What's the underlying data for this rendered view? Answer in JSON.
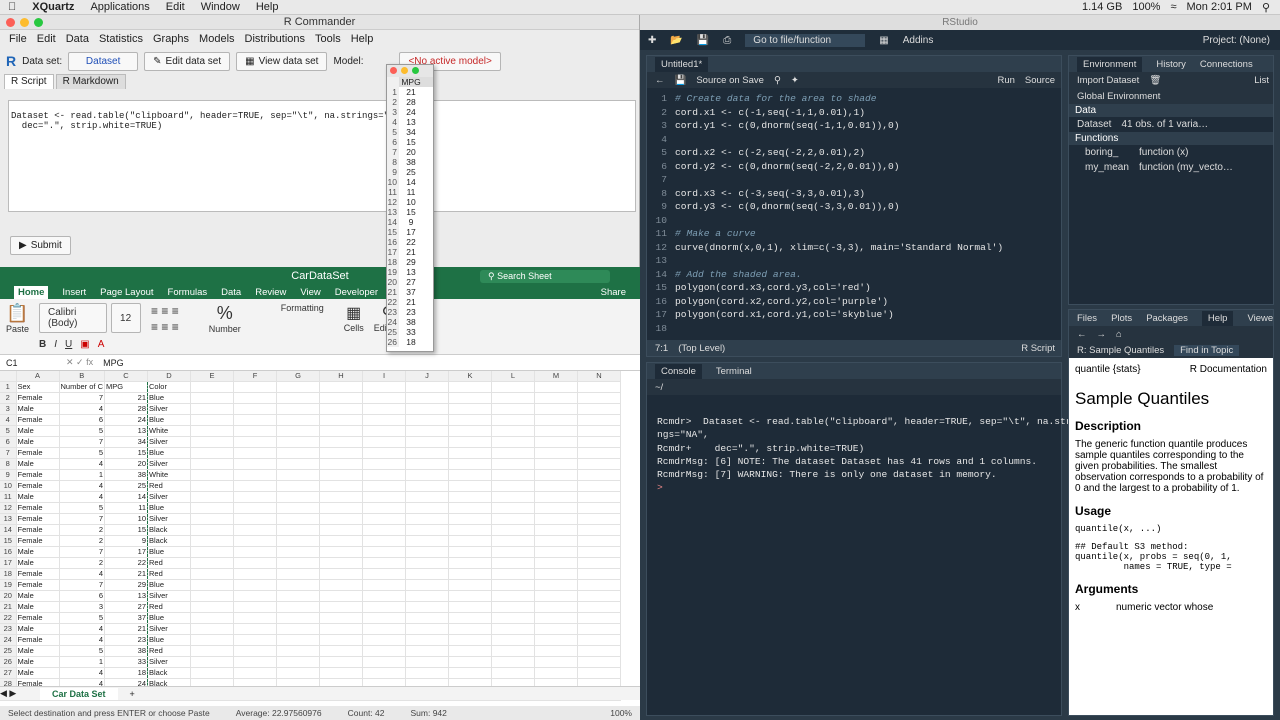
{
  "menubar": {
    "app": "XQuartz",
    "items": [
      "Applications",
      "Edit",
      "Window",
      "Help"
    ],
    "status": "1.14 GB",
    "battery": "100%",
    "time": "Mon 2:01 PM"
  },
  "rcmdr": {
    "title": "R Commander",
    "menu": [
      "File",
      "Edit",
      "Data",
      "Statistics",
      "Graphs",
      "Models",
      "Distributions",
      "Tools",
      "Help"
    ],
    "dataset_label": "Data set:",
    "dataset_value": "Dataset",
    "edit_btn": "Edit data set",
    "view_btn": "View data set",
    "model_label": "Model:",
    "model_value": "<No active model>",
    "tabs": [
      "R Script",
      "R Markdown"
    ],
    "script_line1": "Dataset <- read.table(\"clipboard\", header=TRUE, sep=\"\\t\", na.strings=\"N",
    "script_line2": "  dec=\".\", strip.white=TRUE)",
    "submit": "Submit"
  },
  "mpg_popup": {
    "header": "MPG",
    "rows": [
      "21",
      "28",
      "24",
      "13",
      "34",
      "15",
      "20",
      "38",
      "25",
      "14",
      "11",
      "10",
      "15",
      "9",
      "17",
      "22",
      "21",
      "29",
      "13",
      "27",
      "37",
      "21",
      "23",
      "38",
      "33",
      "18"
    ]
  },
  "excel": {
    "title": "CarDataSet",
    "search_placeholder": "Search Sheet",
    "tabs": [
      "Home",
      "Insert",
      "Page Layout",
      "Formulas",
      "Data",
      "Review",
      "View",
      "Developer"
    ],
    "share": "Share",
    "font": "Calibri (Body)",
    "size": "12",
    "paste": "Paste",
    "number": "Number",
    "cells": "Cells",
    "editing": "Editing",
    "formatting": "Formatting",
    "cellref": "C1",
    "formula": "MPG",
    "cols": [
      "A",
      "B",
      "C",
      "D",
      "E",
      "F",
      "G",
      "H",
      "I",
      "J",
      "K",
      "L",
      "M",
      "N"
    ],
    "header": [
      "Sex",
      "Number of C",
      "MPG",
      "Color"
    ],
    "rows": [
      [
        "Female",
        "7",
        "21",
        "Blue"
      ],
      [
        "Male",
        "4",
        "28",
        "Silver"
      ],
      [
        "Female",
        "6",
        "24",
        "Blue"
      ],
      [
        "Male",
        "5",
        "13",
        "White"
      ],
      [
        "Male",
        "7",
        "34",
        "Silver"
      ],
      [
        "Female",
        "5",
        "15",
        "Blue"
      ],
      [
        "Male",
        "4",
        "20",
        "Silver"
      ],
      [
        "Female",
        "1",
        "38",
        "White"
      ],
      [
        "Female",
        "4",
        "25",
        "Red"
      ],
      [
        "Male",
        "4",
        "14",
        "Silver"
      ],
      [
        "Female",
        "5",
        "11",
        "Blue"
      ],
      [
        "Female",
        "7",
        "10",
        "Silver"
      ],
      [
        "Female",
        "2",
        "15",
        "Black"
      ],
      [
        "Female",
        "2",
        "9",
        "Black"
      ],
      [
        "Male",
        "7",
        "17",
        "Blue"
      ],
      [
        "Male",
        "2",
        "22",
        "Red"
      ],
      [
        "Female",
        "4",
        "21",
        "Red"
      ],
      [
        "Female",
        "7",
        "29",
        "Blue"
      ],
      [
        "Male",
        "6",
        "13",
        "Silver"
      ],
      [
        "Male",
        "3",
        "27",
        "Red"
      ],
      [
        "Female",
        "5",
        "37",
        "Blue"
      ],
      [
        "Male",
        "4",
        "21",
        "Silver"
      ],
      [
        "Female",
        "4",
        "23",
        "Blue"
      ],
      [
        "Male",
        "5",
        "38",
        "Red"
      ],
      [
        "Male",
        "1",
        "33",
        "Silver"
      ],
      [
        "Male",
        "4",
        "18",
        "Black"
      ],
      [
        "Female",
        "4",
        "24",
        "Black"
      ],
      [
        "Male",
        "2",
        "34",
        "Blue"
      ]
    ],
    "sheet_tab": "Car Data Set",
    "status_msg": "Select destination and press ENTER or choose Paste",
    "average": "Average: 22.97560976",
    "count": "Count: 42",
    "sum": "Sum: 942",
    "zoom": "100%"
  },
  "rstudio": {
    "title": "RStudio",
    "goto": "Go to file/function",
    "addins": "Addins",
    "project": "Project: (None)",
    "editor_tab": "Untitled1*",
    "source_on_save": "Source on Save",
    "run": "Run",
    "source": "Source",
    "code": [
      {
        "t": "cmt",
        "s": "# Create data for the area to shade"
      },
      {
        "t": "c",
        "s": "cord.x1 <- c(-1,seq(-1,1,0.01),1)"
      },
      {
        "t": "c",
        "s": "cord.y1 <- c(0,dnorm(seq(-1,1,0.01)),0)"
      },
      {
        "t": "c",
        "s": ""
      },
      {
        "t": "c",
        "s": "cord.x2 <- c(-2,seq(-2,2,0.01),2)"
      },
      {
        "t": "c",
        "s": "cord.y2 <- c(0,dnorm(seq(-2,2,0.01)),0)"
      },
      {
        "t": "c",
        "s": ""
      },
      {
        "t": "c",
        "s": "cord.x3 <- c(-3,seq(-3,3,0.01),3)"
      },
      {
        "t": "c",
        "s": "cord.y3 <- c(0,dnorm(seq(-3,3,0.01)),0)"
      },
      {
        "t": "c",
        "s": ""
      },
      {
        "t": "cmt",
        "s": "# Make a curve"
      },
      {
        "t": "c",
        "s": "curve(dnorm(x,0,1), xlim=c(-3,3), main='Standard Normal')"
      },
      {
        "t": "c",
        "s": ""
      },
      {
        "t": "cmt",
        "s": "# Add the shaded area."
      },
      {
        "t": "c",
        "s": "polygon(cord.x3,cord.y3,col='red')"
      },
      {
        "t": "c",
        "s": "polygon(cord.x2,cord.y2,col='purple')"
      },
      {
        "t": "c",
        "s": "polygon(cord.x1,cord.y1,col='skyblue')"
      },
      {
        "t": "c",
        "s": ""
      }
    ],
    "cursor_pos": "7:1",
    "scope": "(Top Level)",
    "lang": "R Script",
    "console_tabs": [
      "Console",
      "Terminal"
    ],
    "console_path": "~/",
    "console": [
      "Rcmdr>  Dataset <- read.table(\"clipboard\", header=TRUE, sep=\"\\t\", na.stri",
      "ngs=\"NA\",",
      "Rcmdr+    dec=\".\", strip.white=TRUE)",
      "RcmdrMsg: [6] NOTE: The dataset Dataset has 41 rows and 1 columns.",
      "RcmdrMsg: [7] WARNING: There is only one dataset in memory.",
      ">"
    ],
    "env_tabs": [
      "Environment",
      "History",
      "Connections"
    ],
    "import": "Import Dataset",
    "list": "List",
    "global_env": "Global Environment",
    "data_hdr": "Data",
    "dataset_name": "Dataset",
    "dataset_desc": "41 obs. of 1 varia…",
    "func_hdr": "Functions",
    "funcs": [
      {
        "n": "boring_",
        "v": "function (x)"
      },
      {
        "n": "my_mean",
        "v": "function (my_vecto…"
      }
    ],
    "help_tabs": [
      "Files",
      "Plots",
      "Packages",
      "Help",
      "Viewer"
    ],
    "help_topic": "R: Sample Quantiles",
    "find_topic": "Find in Topic",
    "help_pkg": "quantile {stats}",
    "help_doc": "R Documentation",
    "help_title": "Sample Quantiles",
    "help_desc_hdr": "Description",
    "help_desc": "The generic function quantile produces sample quantiles corresponding to the given probabilities. The smallest observation corresponds to a probability of 0 and the largest to a probability of 1.",
    "usage_hdr": "Usage",
    "usage1": "quantile(x, ...)",
    "usage2": "## Default S3 method:",
    "usage3": "quantile(x, probs = seq(0, 1,",
    "usage4": "         names = TRUE, type =",
    "args_hdr": "Arguments",
    "arg_x": "x",
    "arg_x_desc": "numeric vector whose"
  }
}
